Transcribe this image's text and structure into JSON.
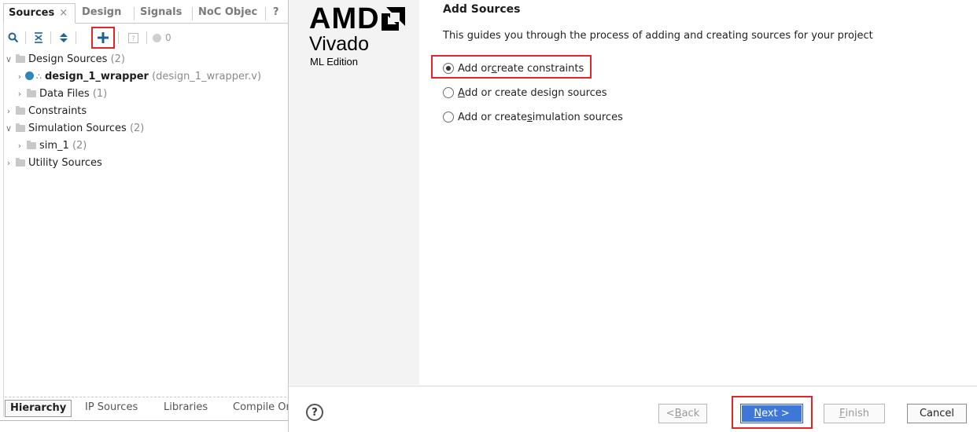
{
  "sources_panel": {
    "tabs": [
      {
        "label": "Sources",
        "close": "×"
      },
      {
        "label": "Design"
      },
      {
        "label": "Signals"
      },
      {
        "label": "NoC Objec"
      },
      {
        "label": "?"
      }
    ],
    "toolbar": {
      "search": "search-icon",
      "collapse_all": "collapse-all-icon",
      "expand_all": "expand-all-icon",
      "add_sources": "plus-icon",
      "properties": "help-square-icon",
      "status_count": "0"
    },
    "tree": {
      "design_sources": {
        "label": "Design Sources",
        "count": "(2)"
      },
      "design_wrapper": {
        "name": "design_1_wrapper",
        "file": "(design_1_wrapper.v)"
      },
      "data_files": {
        "label": "Data Files",
        "count": "(1)"
      },
      "constraints": {
        "label": "Constraints"
      },
      "simulation_sources": {
        "label": "Simulation Sources",
        "count": "(2)"
      },
      "sim_1": {
        "label": "sim_1",
        "count": "(2)"
      },
      "utility_sources": {
        "label": "Utility Sources"
      }
    },
    "bottom_tabs": [
      "Hierarchy",
      "IP Sources",
      "Libraries",
      "Compile Or"
    ]
  },
  "dialog": {
    "brand": {
      "logo": "AMD",
      "product": "Vivado",
      "edition": "ML Edition"
    },
    "title": "Add Sources",
    "description": "This guides you through the process of adding and creating sources for your project",
    "options": {
      "constraints": {
        "pre": "Add or ",
        "key": "c",
        "post": "reate constraints",
        "selected": true
      },
      "design": {
        "pre": "",
        "key": "A",
        "post": "dd or create design sources",
        "selected": false
      },
      "simulation": {
        "pre": "Add or create ",
        "key": "s",
        "post": "imulation sources",
        "selected": false
      }
    },
    "buttons": {
      "help": "?",
      "back": {
        "pre": "< ",
        "key": "B",
        "post": "ack"
      },
      "next": {
        "pre": "",
        "key": "N",
        "post": "ext >"
      },
      "finish": {
        "pre": "",
        "key": "F",
        "post": "inish"
      },
      "cancel": "Cancel"
    }
  },
  "colors": {
    "highlight": "#e0262b",
    "accent": "#3d78d8",
    "icon_blue": "#1f5f9f"
  }
}
